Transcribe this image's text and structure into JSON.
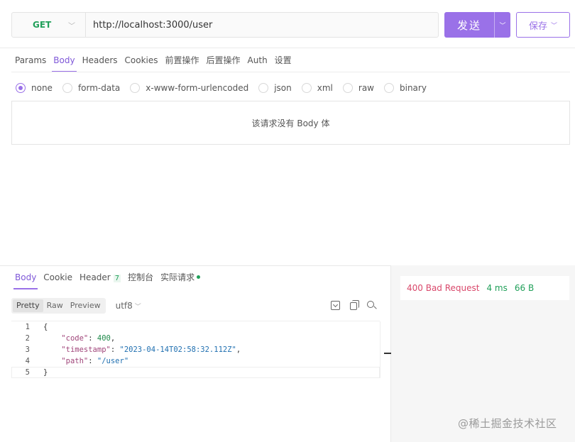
{
  "request": {
    "method": "GET",
    "url": "http://localhost:3000/user",
    "send_label": "发送",
    "save_label": "保存"
  },
  "request_tabs": [
    "Params",
    "Body",
    "Headers",
    "Cookies",
    "前置操作",
    "后置操作",
    "Auth",
    "设置"
  ],
  "request_active_tab": "Body",
  "body_types": [
    "none",
    "form-data",
    "x-www-form-urlencoded",
    "json",
    "xml",
    "raw",
    "binary"
  ],
  "body_selected": "none",
  "empty_body_text": "该请求没有 Body 体",
  "response_tabs": {
    "body": "Body",
    "cookie": "Cookie",
    "header": "Header",
    "header_count": "7",
    "console": "控制台",
    "actual_request": "实际请求"
  },
  "format": {
    "pretty": "Pretty",
    "raw": "Raw",
    "preview": "Preview",
    "encoding": "utf8",
    "active": "Pretty"
  },
  "code_lines": {
    "l1": "{",
    "l2_key": "\"code\"",
    "l2_val": "400",
    "l3_key": "\"timestamp\"",
    "l3_val": "\"2023-04-14T02:58:32.112Z\"",
    "l4_key": "\"path\"",
    "l4_val": "\"/user\"",
    "l5": "}"
  },
  "line_numbers": [
    "1",
    "2",
    "3",
    "4",
    "5"
  ],
  "status": {
    "code": "400 Bad Request",
    "time": "4 ms",
    "size": "66 B"
  },
  "watermark": "@稀土掘金技术社区",
  "colors": {
    "accent": "#9a71e8",
    "get_method": "#21a05a",
    "status_error": "#d9486b",
    "status_ok": "#21a05a"
  }
}
